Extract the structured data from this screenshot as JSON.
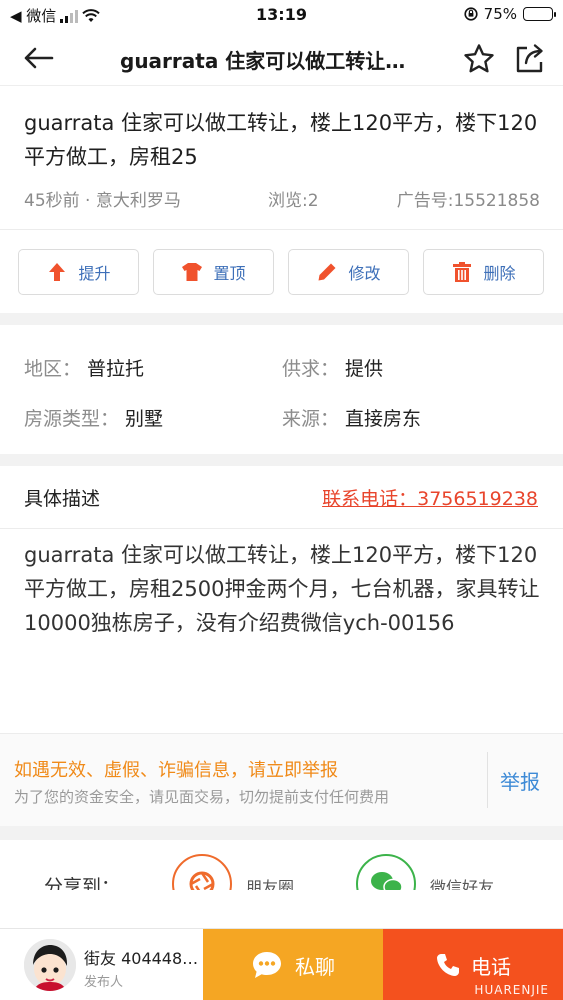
{
  "status_bar": {
    "carrier": "◀ 微信",
    "time": "13:19",
    "battery": "75%",
    "battery_level": 0.75
  },
  "nav": {
    "title": "guarrata 住家可以做工转让…"
  },
  "ad": {
    "title": "guarrata 住家可以做工转让，楼上120平方，楼下120平方做工，房租25",
    "time_location": "45秒前 · 意大利罗马",
    "views": "浏览:2",
    "ad_number": "广告号:15521858"
  },
  "actions": {
    "promote": "提升",
    "pin": "置顶",
    "edit": "修改",
    "delete": "删除"
  },
  "info": {
    "region_key": "地区：",
    "region_val": "普拉托",
    "supply_key": "供求：",
    "supply_val": "提供",
    "type_key": "房源类型：",
    "type_val": "别墅",
    "source_key": "来源：",
    "source_val": "直接房东"
  },
  "description": {
    "heading": "具体描述",
    "contact": "联系电话：3756519238",
    "body": "guarrata  住家可以做工转让，楼上120平方，楼下120平方做工，房租2500押金两个月，七台机器，家具转让10000独栋房子，没有介绍费微信ych-00156"
  },
  "warning": {
    "main": "如遇无效、虚假、诈骗信息，请立即举报",
    "sub": "为了您的资金安全，请见面交易，切勿提前支付任何费用",
    "report": "举报"
  },
  "share": {
    "label": "分享到：",
    "moments": "朋友圈",
    "wechat": "微信好友"
  },
  "bottom": {
    "poster_name": "街友 404448…",
    "poster_role": "发布人",
    "chat": "私聊",
    "call": "电话",
    "watermark": "HUARENJIE"
  },
  "colors": {
    "accent_blue": "#3d6fb8",
    "orange": "#f5a623",
    "red_orange": "#f4511e",
    "icon_red": "#f0522d",
    "warning_orange": "#f08a18"
  }
}
